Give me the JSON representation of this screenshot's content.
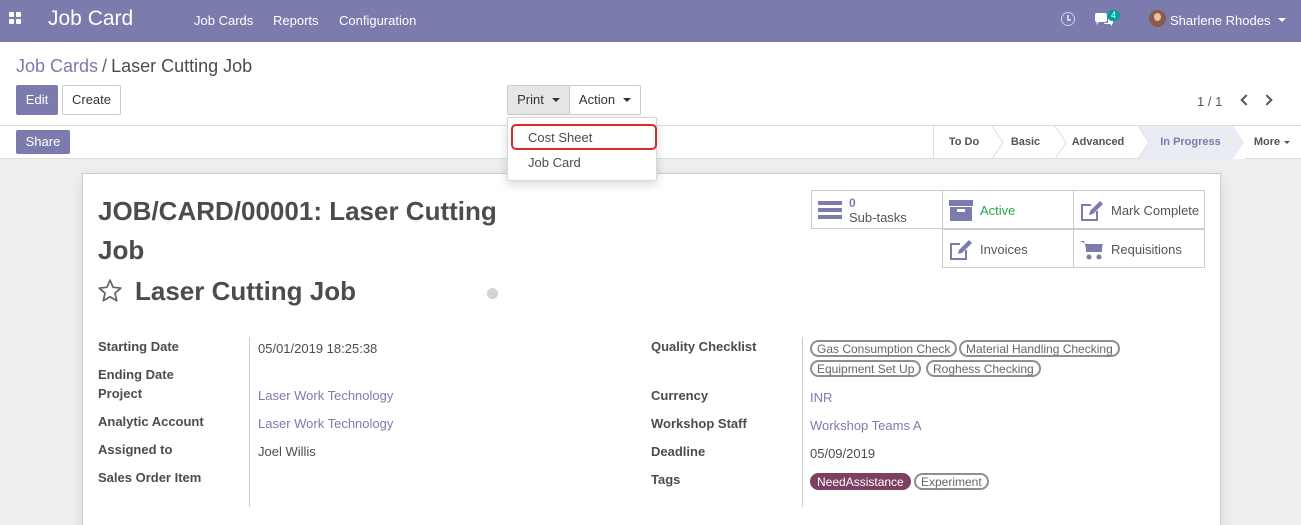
{
  "navbar": {
    "app_title": "Job Card",
    "menus": [
      "Job Cards",
      "Reports",
      "Configuration"
    ],
    "chat_count": "4",
    "user_name": "Sharlene Rhodes"
  },
  "breadcrumb": {
    "parent": "Job Cards",
    "separator": "/",
    "current": "Laser Cutting Job"
  },
  "buttons": {
    "edit": "Edit",
    "create": "Create",
    "print": "Print",
    "action": "Action",
    "share": "Share"
  },
  "pager": {
    "value": "1 / 1"
  },
  "print_menu": [
    "Cost Sheet",
    "Job Card"
  ],
  "stages": [
    "To Do",
    "Basic",
    "Advanced",
    "In Progress",
    "More"
  ],
  "active_stage": "In Progress",
  "record": {
    "title": "JOB/CARD/00001: Laser Cutting Job",
    "name": "Laser Cutting Job"
  },
  "smart_buttons": {
    "subtasks_count": "0",
    "subtasks_label": "Sub-tasks",
    "active": "Active",
    "mark_complete": "Mark Complete",
    "invoices": "Invoices",
    "requisitions": "Requisitions"
  },
  "fields_left": {
    "starting_date_label": "Starting Date",
    "starting_date": "05/01/2019 18:25:38",
    "ending_date_label": "Ending Date",
    "project_label": "Project",
    "project": "Laser Work Technology",
    "analytic_account_label": "Analytic Account",
    "analytic_account": "Laser Work Technology",
    "assigned_to_label": "Assigned to",
    "assigned_to": "Joel Willis",
    "sales_order_item_label": "Sales Order Item"
  },
  "fields_right": {
    "quality_checklist_label": "Quality Checklist",
    "quality_checklist": [
      "Gas Consumption Check",
      "Material Handling Checking",
      "Equipment Set Up",
      "Roghess Checking"
    ],
    "currency_label": "Currency",
    "currency": "INR",
    "workshop_staff_label": "Workshop Staff",
    "workshop_staff": "Workshop Teams A",
    "deadline_label": "Deadline",
    "deadline": "05/09/2019",
    "tags_label": "Tags",
    "tags": [
      "NeedAssistance",
      "Experiment"
    ]
  },
  "colors": {
    "brand": "#7c7bad",
    "active_green": "#28a745",
    "tag_need_assistance": "#7d3f62",
    "highlight_red": "#d8282e"
  }
}
